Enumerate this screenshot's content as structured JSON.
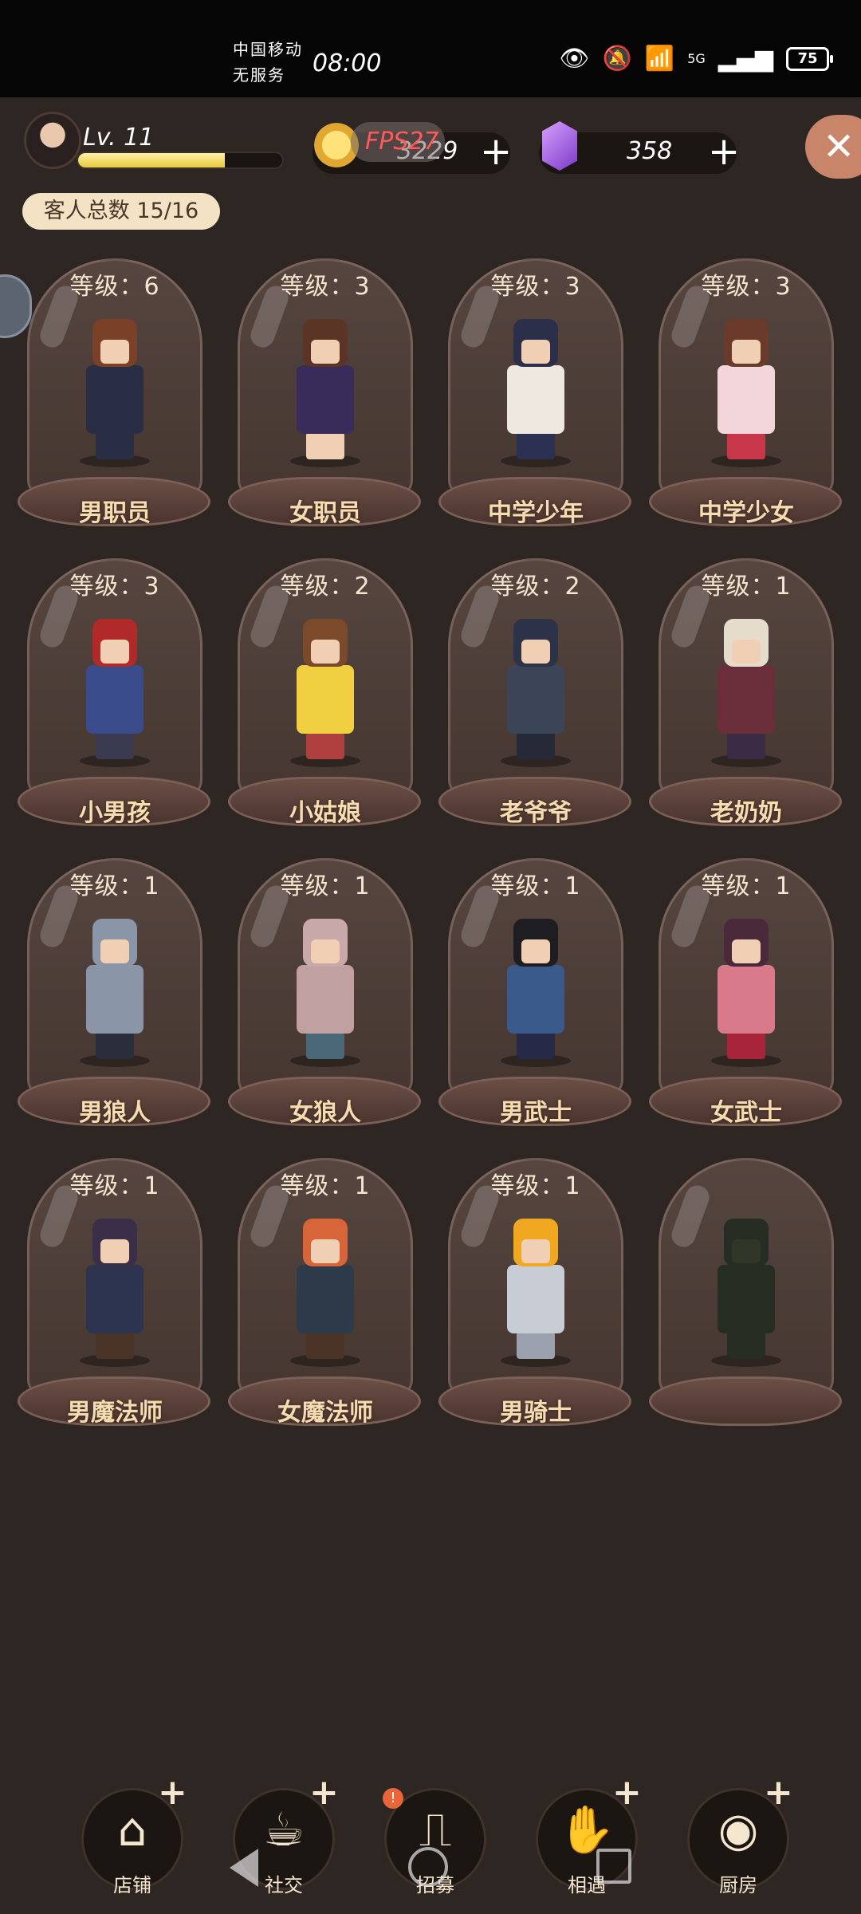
{
  "status_bar": {
    "carrier_line1": "中国移动",
    "carrier_line2": "无服务",
    "time": "08:00",
    "battery": "75",
    "network": "5G"
  },
  "header": {
    "level": "Lv. 11",
    "xp_progress": 0.72,
    "fps_label": "FPS27",
    "coins": "3229",
    "gems": "358",
    "plus": "+",
    "close": "✕",
    "guest_total": "客人总数 15/16"
  },
  "guests": [
    {
      "level": "等级：6",
      "name": "男职员",
      "hair": "#7a4028",
      "body": "#2a2e44",
      "legs": "#2a2e44"
    },
    {
      "level": "等级：3",
      "name": "女职员",
      "hair": "#5a3424",
      "body": "#3a2c5a",
      "legs": "#f0cfb4"
    },
    {
      "level": "等级：3",
      "name": "中学少年",
      "hair": "#2c2f4a",
      "body": "#eee8e0",
      "legs": "#2c3050"
    },
    {
      "level": "等级：3",
      "name": "中学少女",
      "hair": "#6a3a2a",
      "body": "#f3d6da",
      "legs": "#c8364a"
    },
    {
      "level": "等级：3",
      "name": "小男孩",
      "hair": "#b02a2a",
      "body": "#3a4c8c",
      "legs": "#3a3a50"
    },
    {
      "level": "等级：2",
      "name": "小姑娘",
      "hair": "#7a4a2a",
      "body": "#f0d040",
      "legs": "#b04040"
    },
    {
      "level": "等级：2",
      "name": "老爷爷",
      "hair": "#2c3248",
      "body": "#3c4458",
      "legs": "#262a38"
    },
    {
      "level": "等级：1",
      "name": "老奶奶",
      "hair": "#e6dccc",
      "body": "#6a2e3a",
      "legs": "#3a2a44"
    },
    {
      "level": "等级：1",
      "name": "男狼人",
      "hair": "#8a96a8",
      "body": "#8a96a8",
      "legs": "#2a2e3a"
    },
    {
      "level": "等级：1",
      "name": "女狼人",
      "hair": "#c8a8a8",
      "body": "#c0a0a0",
      "legs": "#4a6878"
    },
    {
      "level": "等级：1",
      "name": "男武士",
      "hair": "#1e1e22",
      "body": "#3a5a8c",
      "legs": "#262a48"
    },
    {
      "level": "等级：1",
      "name": "女武士",
      "hair": "#4a2a3a",
      "body": "#d87a8a",
      "legs": "#a8243a"
    },
    {
      "level": "等级：1",
      "name": "男魔法师",
      "hair": "#3a2e48",
      "body": "#2c3450",
      "legs": "#4a3428"
    },
    {
      "level": "等级：1",
      "name": "女魔法师",
      "hair": "#d8643a",
      "body": "#2c3a4a",
      "legs": "#4a3428"
    },
    {
      "level": "等级：1",
      "name": "男骑士",
      "hair": "#f0a820",
      "body": "#c8ccd4",
      "legs": "#9aa0ac"
    },
    {
      "level": "",
      "name": "",
      "hair": "#262d22",
      "body": "#262d22",
      "legs": "#262d22",
      "locked": true
    }
  ],
  "bottom_nav": [
    {
      "label": "店铺",
      "icon": "shop-icon",
      "glyph": "⌂",
      "plus": "+"
    },
    {
      "label": "社交",
      "icon": "coffee-cup-icon",
      "glyph": "☕",
      "plus": "+"
    },
    {
      "label": "招募",
      "icon": "recruit-door-icon",
      "glyph": "⎍",
      "badge": "!"
    },
    {
      "label": "相遇",
      "icon": "handshake-icon",
      "glyph": "✋",
      "plus": "+"
    },
    {
      "label": "厨房",
      "icon": "frying-pan-icon",
      "glyph": "◉",
      "plus": "+"
    }
  ]
}
